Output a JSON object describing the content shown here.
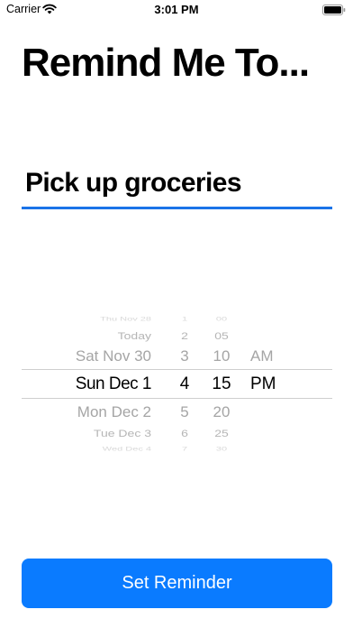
{
  "status_bar": {
    "carrier": "Carrier",
    "time": "3:01 PM"
  },
  "title": "Remind Me To...",
  "task_input": {
    "value": "Pick up groceries"
  },
  "picker": {
    "dates": [
      "Thu Nov 28",
      "Today",
      "Sat Nov 30",
      "Sun Dec 1",
      "Mon Dec 2",
      "Tue Dec 3",
      "Wed Dec 4"
    ],
    "hours": [
      "1",
      "2",
      "3",
      "4",
      "5",
      "6",
      "7"
    ],
    "minutes": [
      "00",
      "05",
      "10",
      "15",
      "20",
      "25",
      "30"
    ],
    "ampm": [
      "AM",
      "PM"
    ],
    "selected": {
      "date": "Sun Dec 1",
      "hour": "4",
      "minute": "15",
      "period": "PM"
    }
  },
  "set_button": {
    "label": "Set Reminder"
  },
  "colors": {
    "accent": "#0a7bff",
    "underline": "#1a73e8"
  },
  "icons": {
    "wifi": "wifi-icon",
    "battery": "battery-icon"
  }
}
